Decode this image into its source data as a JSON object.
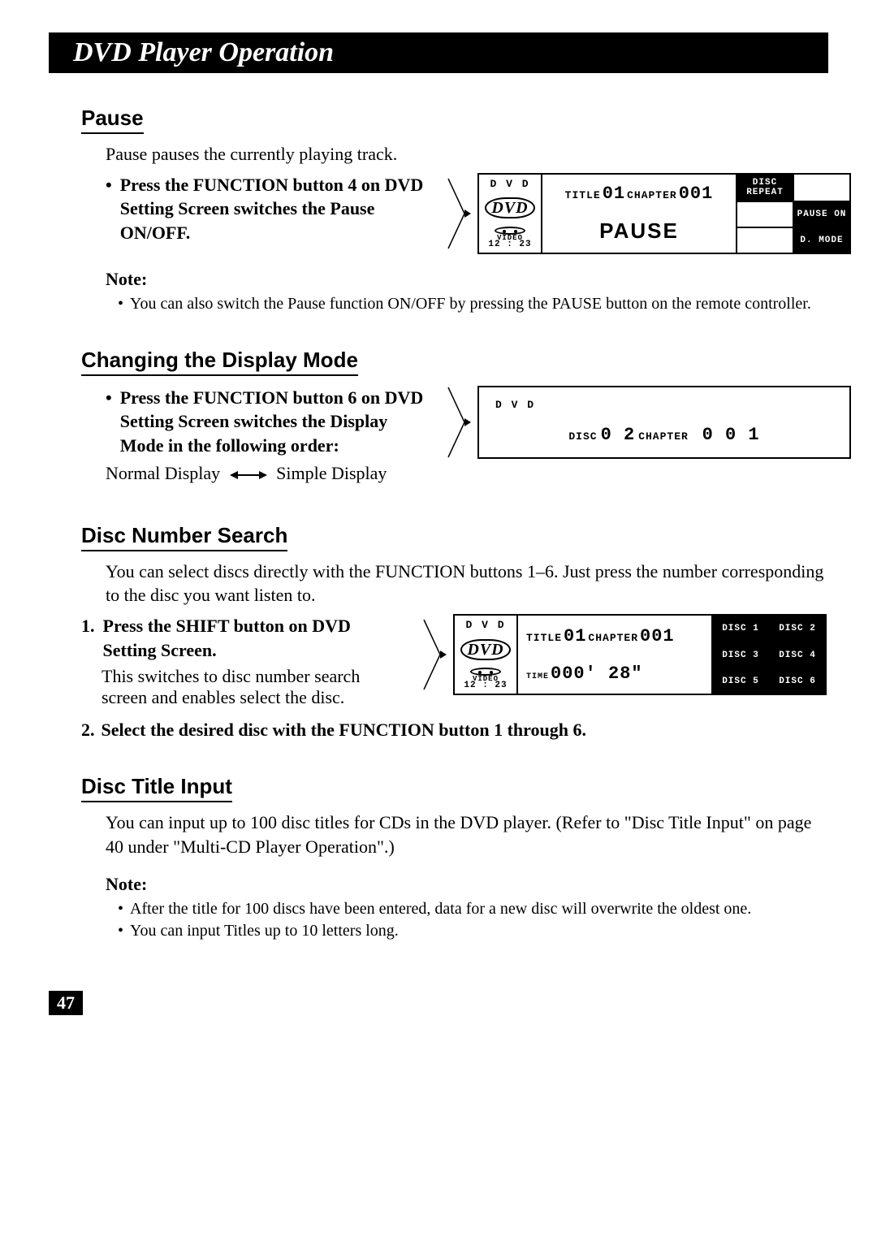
{
  "page_title": "DVD Player Operation",
  "page_number": "47",
  "pause": {
    "heading": "Pause",
    "intro": "Pause pauses the currently playing track.",
    "bullet": "Press the FUNCTION button 4 on DVD Setting Screen switches the Pause ON/OFF.",
    "note_heading": "Note:",
    "note1": "You can also switch the Pause function ON/OFF by pressing the PAUSE button on the remote controller."
  },
  "display_mode": {
    "heading": "Changing the Display Mode",
    "bullet": "Press the FUNCTION button 6 on DVD Setting Screen switches the Display Mode in the following order:",
    "normal": "Normal Display",
    "simple": "Simple Display"
  },
  "disc_search": {
    "heading": "Disc Number Search",
    "intro": "You can select discs directly with the FUNCTION buttons 1–6. Just press the number corresponding to the disc you want listen to.",
    "step1": "Press the SHIFT button on DVD Setting Screen.",
    "step1_sub": "This switches to disc number search screen and enables select the disc.",
    "step2": "Select the desired disc with the FUNCTION button 1 through 6."
  },
  "title_input": {
    "heading": "Disc Title Input",
    "intro": "You can input up to 100 disc titles for CDs in the DVD player. (Refer to \"Disc Title Input\" on page 40 under \"Multi-CD Player Operation\".)",
    "note_heading": "Note:",
    "note1": "After the title for 100 discs have been entered, data for a new disc will overwrite the oldest one.",
    "note2": "You can input Titles up to 10 letters long."
  },
  "lcd": {
    "dvd": "D V D",
    "video": "VIDEO",
    "time_label": "12 : 23",
    "title_lbl": "TITLE",
    "title_val": "01",
    "chapter_lbl": "CHAPTER",
    "chapter_val": "001",
    "pause": "PAUSE",
    "disc_repeat": "DISC REPEAT",
    "pause_on": "PAUSE ON",
    "dmode": "D. MODE",
    "disc_lbl": "DISC",
    "disc_val": "0 2",
    "simple_chapter_val": "0 0 1",
    "time_lbl2": "TIME",
    "time_val2": "000' 28\"",
    "disc1": "DISC 1",
    "disc2": "DISC 2",
    "disc3": "DISC 3",
    "disc4": "DISC 4",
    "disc5": "DISC 5",
    "disc6": "DISC 6"
  }
}
